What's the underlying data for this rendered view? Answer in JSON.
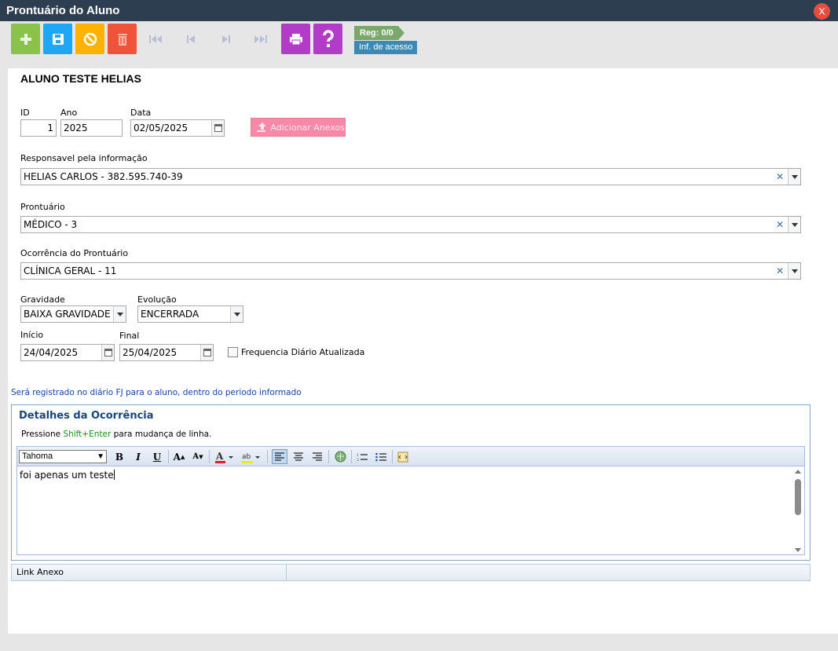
{
  "window": {
    "title": "Prontuário do Aluno",
    "close_label": "X"
  },
  "toolbar": {
    "record_counter": "Reg: 0/0",
    "access_info": "Inf. de acesso",
    "colors": {
      "add": "#8bc34a",
      "save": "#1ea7f5",
      "cancel": "#ffb300",
      "delete": "#f0533a",
      "print": "#b23bc8",
      "help": "#b23bc8"
    }
  },
  "header": {
    "student_name": "ALUNO TESTE HELIAS"
  },
  "form": {
    "id": {
      "label": "ID",
      "value": "1"
    },
    "ano": {
      "label": "Ano",
      "value": "2025"
    },
    "data": {
      "label": "Data",
      "value": "02/05/2025"
    },
    "add_attachments_label": "Adicionar Anexos",
    "responsavel": {
      "label": "Responsavel pela informação",
      "value": "HELIAS CARLOS - 382.595.740-39"
    },
    "prontuario": {
      "label": "Prontuário",
      "value": "MÉDICO - 3"
    },
    "ocorrencia": {
      "label": "Ocorrência do Prontuário",
      "value": "CLÍNICA GERAL - 11"
    },
    "gravidade": {
      "label": "Gravidade",
      "value": "BAIXA GRAVIDADE"
    },
    "evolucao": {
      "label": "Evolução",
      "value": "ENCERRADA"
    },
    "inicio": {
      "label": "Início",
      "value": "24/04/2025"
    },
    "final": {
      "label": "Final",
      "value": "25/04/2025"
    },
    "frequencia": {
      "label": "Frequencia Diário Atualizada",
      "checked": false
    },
    "note": "Será registrado no diário FJ para o aluno, dentro do periodo informado"
  },
  "details": {
    "title": "Detalhes da Ocorrência",
    "hint_prefix": "Pressione ",
    "hint_keys": "Shift+Enter",
    "hint_suffix": " para mudança de linha.",
    "font_name": "Tahoma",
    "text": "foi apenas um teste"
  },
  "attachments": {
    "column_label": "Link Anexo"
  }
}
